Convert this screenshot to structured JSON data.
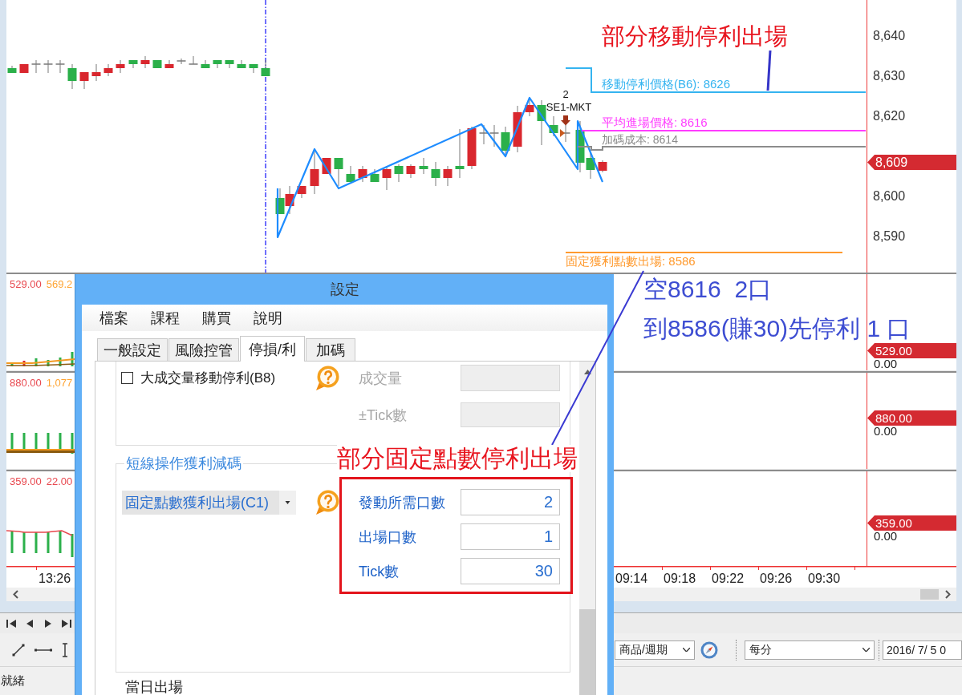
{
  "chart": {
    "price_axis": {
      "labels": [
        "8,640",
        "8,630",
        "8,620",
        "8,600",
        "8,590"
      ],
      "current_price": "8,609"
    },
    "price_lines": [
      {
        "kind": "trailing_stop",
        "label": "移動停利價格(B6): 8626",
        "color": "#35b4f0"
      },
      {
        "kind": "average_entry",
        "label": "平均進場價格: 8616",
        "color": "#ff3cff"
      },
      {
        "kind": "added_cost",
        "label": "加碼成本: 8614",
        "color": "#8c8c8c"
      },
      {
        "kind": "fixed_target",
        "label": "固定獲利點數出場: 8586",
        "color": "#ff9a2e"
      }
    ],
    "order_marker": {
      "quantity": "2",
      "label": "SE1-MKT"
    }
  },
  "panes": [
    {
      "values": [
        {
          "text": "529.00",
          "color": "#e8484f"
        },
        {
          "text": "569.2",
          "color": "#ffa534"
        }
      ],
      "tag": "529.00",
      "axis_label": "0.00"
    },
    {
      "values": [
        {
          "text": "880.00",
          "color": "#e8484f"
        },
        {
          "text": "1,077",
          "color": "#ffa534"
        }
      ],
      "tag": "880.00",
      "axis_label": "0.00"
    },
    {
      "values": [
        {
          "text": "359.00",
          "color": "#e8484f"
        },
        {
          "text": "22.00",
          "color": "#e8484f"
        }
      ],
      "tag": "359.00",
      "axis_label": "0.00"
    }
  ],
  "time_axis": {
    "labels": [
      "13:26",
      "09:14",
      "09:18",
      "09:22",
      "09:26",
      "09:30"
    ]
  },
  "annotations": {
    "chart_note": "部分移動停利出場",
    "position_notes": [
      "空8616  2口",
      "到8586(賺30)先停利 1 口"
    ],
    "dialog_note": "部分固定點數停利出場"
  },
  "dialog": {
    "title": "設定",
    "menu": [
      "檔案",
      "課程",
      "購買",
      "說明"
    ],
    "tabs": [
      {
        "label": "一般設定",
        "selected": false
      },
      {
        "label": "風險控管",
        "selected": false
      },
      {
        "label": "停損/利",
        "selected": true
      },
      {
        "label": "加碼",
        "selected": false
      }
    ],
    "volume_trailing": {
      "checkbox": {
        "label": "大成交量移動停利(B8)",
        "checked": false
      },
      "fields": [
        {
          "label": "成交量",
          "disabled": true
        },
        {
          "label": "±Tick數",
          "disabled": true
        }
      ]
    },
    "scalp_reduce": {
      "title": "短線操作獲利減碼",
      "mode": "固定點數獲利出場(C1)",
      "fields": [
        {
          "label": "發動所需口數",
          "value": "2",
          "disabled": false
        },
        {
          "label": "出場口數",
          "value": "1",
          "disabled": false
        },
        {
          "label": "Tick數",
          "value": "30",
          "disabled": false
        }
      ]
    },
    "next_group": {
      "title": "當日出場"
    }
  },
  "toolbar": {
    "symbol_period": "商品/週期",
    "interval": "每分",
    "date": "2016/ 7/ 5 0"
  },
  "status_bar": {
    "text": "就緒"
  }
}
